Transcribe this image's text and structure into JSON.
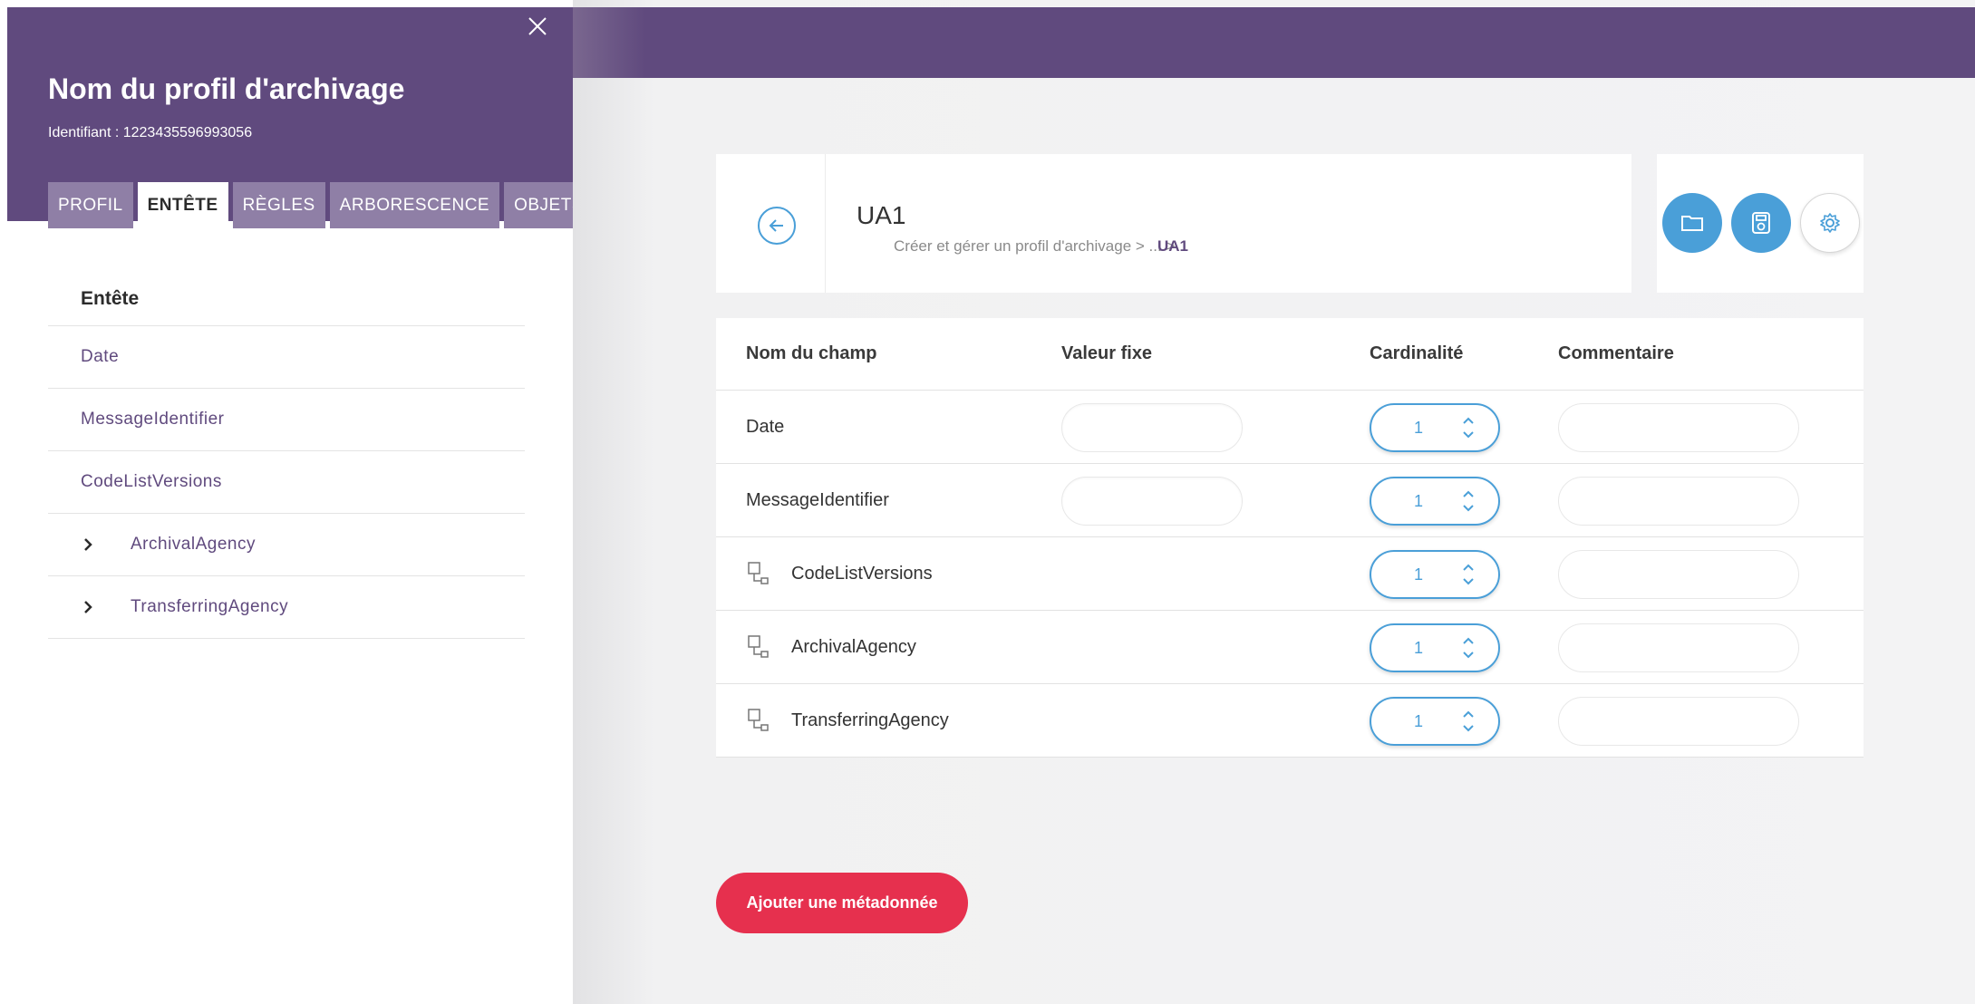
{
  "sidebar": {
    "title": "Nom du profil d'archivage",
    "identifier_label": "Identifiant : ",
    "identifier_value": "1223435596993056",
    "tabs": [
      {
        "label": "PROFIL",
        "active": false
      },
      {
        "label": "ENTÊTE",
        "active": true
      },
      {
        "label": "RÈGLES",
        "active": false
      },
      {
        "label": "ARBORESCENCE",
        "active": false
      },
      {
        "label": "OBJETS",
        "active": false
      }
    ],
    "tree": {
      "title": "Entête",
      "items": [
        {
          "label": "Date",
          "expandable": false
        },
        {
          "label": "MessageIdentifier",
          "expandable": false
        },
        {
          "label": "CodeListVersions",
          "expandable": false
        },
        {
          "label": "ArchivalAgency",
          "expandable": true
        },
        {
          "label": "TransferringAgency",
          "expandable": true
        }
      ]
    }
  },
  "header": {
    "title": "UA1",
    "breadcrumb": "Créer et gérer un profil d'archivage > ... >",
    "breadcrumb_current": "UA1"
  },
  "actions": {
    "icons": [
      "folder-icon",
      "save-icon",
      "settings-icon"
    ]
  },
  "table": {
    "columns": [
      "Nom du champ",
      "Valeur fixe",
      "Cardinalité",
      "Commentaire"
    ],
    "rows": [
      {
        "name": "Date",
        "has_icon": false,
        "has_value_field": true,
        "value": "",
        "cardinality": "1",
        "comment": ""
      },
      {
        "name": "MessageIdentifier",
        "has_icon": false,
        "has_value_field": true,
        "value": "",
        "cardinality": "1",
        "comment": ""
      },
      {
        "name": "CodeListVersions",
        "has_icon": true,
        "has_value_field": false,
        "value": "",
        "cardinality": "1",
        "comment": ""
      },
      {
        "name": "ArchivalAgency",
        "has_icon": true,
        "has_value_field": false,
        "value": "",
        "cardinality": "1",
        "comment": ""
      },
      {
        "name": "TransferringAgency",
        "has_icon": true,
        "has_value_field": false,
        "value": "",
        "cardinality": "1",
        "comment": ""
      }
    ]
  },
  "add_button": {
    "label": "Ajouter une métadonnée"
  },
  "colors": {
    "brand_purple": "#604a7e",
    "tab_inactive": "#8f7fa6",
    "accent_blue": "#4a9fd8",
    "danger_red": "#e6304e"
  }
}
